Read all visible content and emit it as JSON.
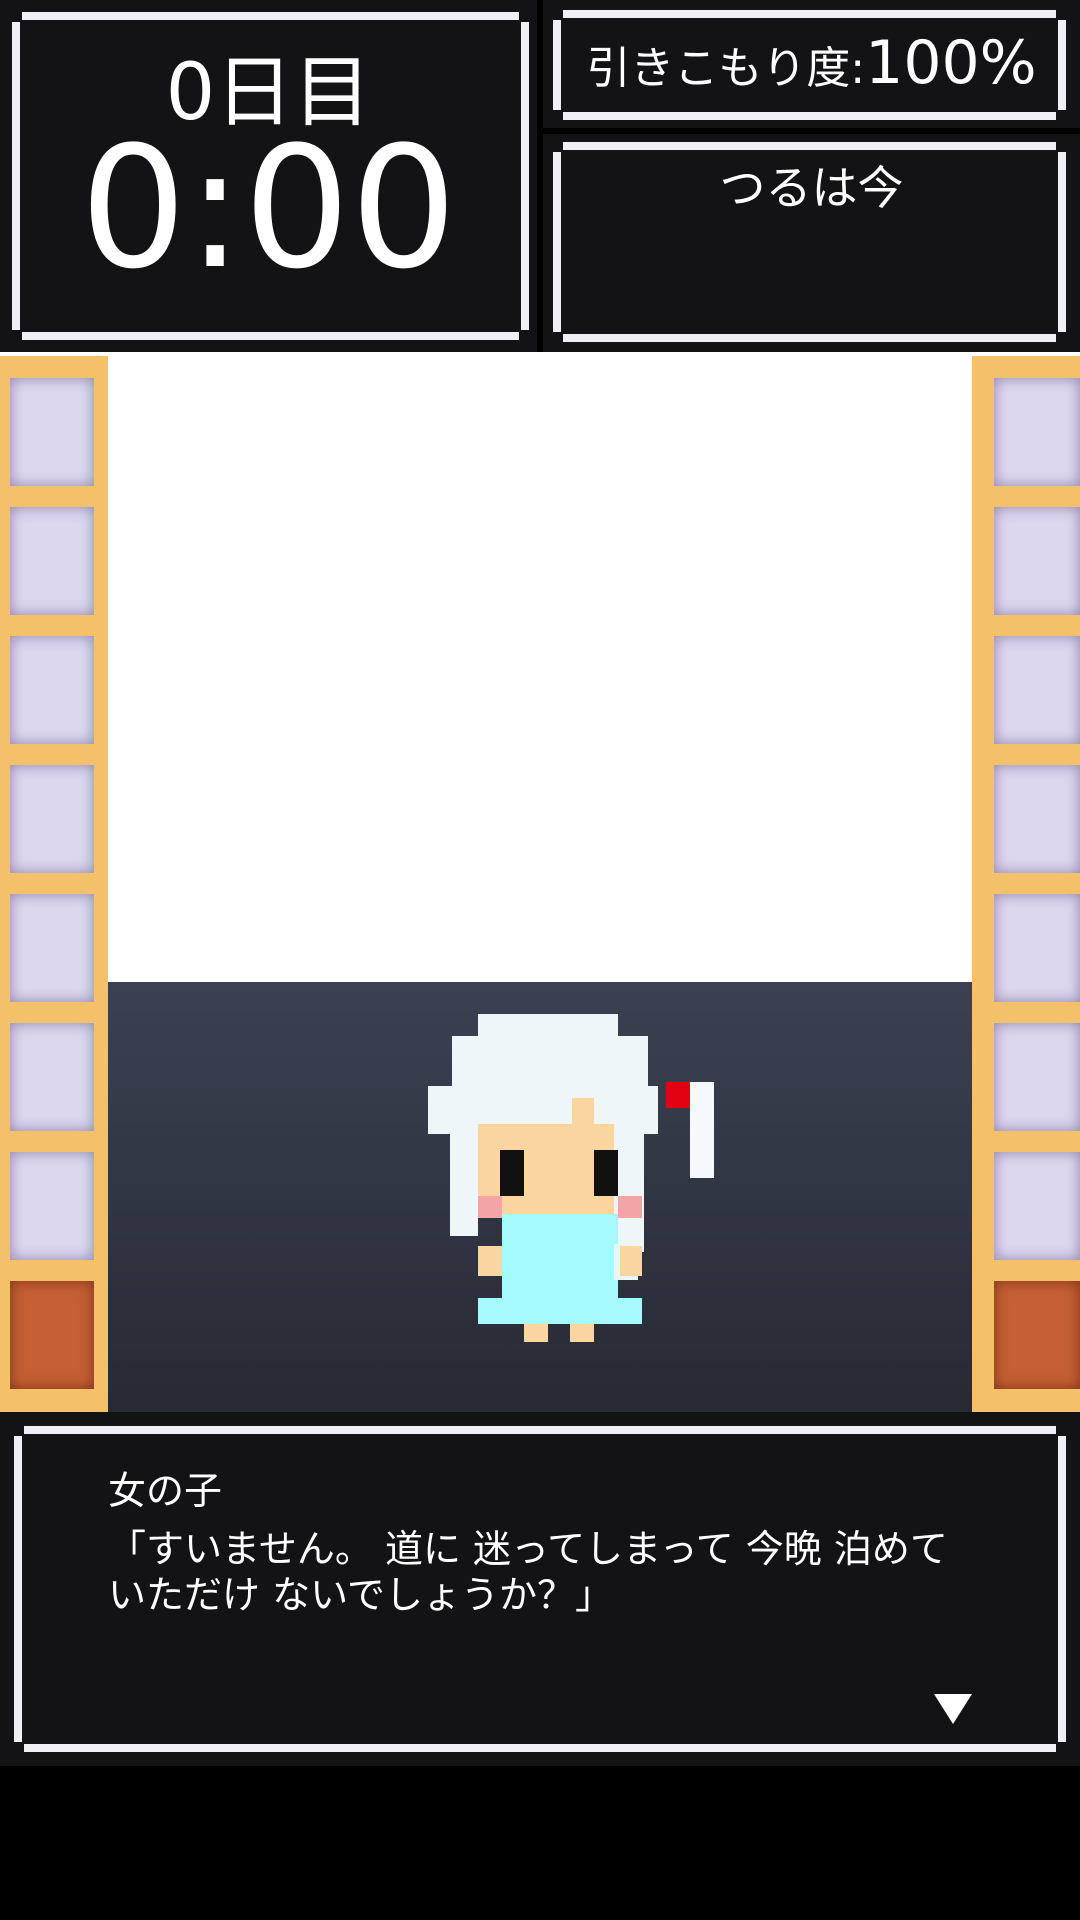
{
  "hud": {
    "day_label": "0日目",
    "clock": "0:00",
    "hikikomori_label": "引きこもり度:",
    "hikikomori_value": "100%",
    "tsuru_label": "つるは今"
  },
  "dialog": {
    "speaker": "女の子",
    "line1": "「すいません。 道に 迷ってしまって 今晩 泊めて",
    "line2": "いただけ ないでしょうか？」"
  },
  "icons": {
    "advance": "triangle-down-icon"
  },
  "colors": {
    "panel": "#131316",
    "frame": "#f1eff6",
    "shoji_frame": "#f5c06a",
    "shoji_paper": "#dcd6ee",
    "door": "#c65f34",
    "floor": "#3b4152",
    "hair": "#eef6f8",
    "dress": "#a5fafd",
    "ribbon": "#e00010"
  }
}
